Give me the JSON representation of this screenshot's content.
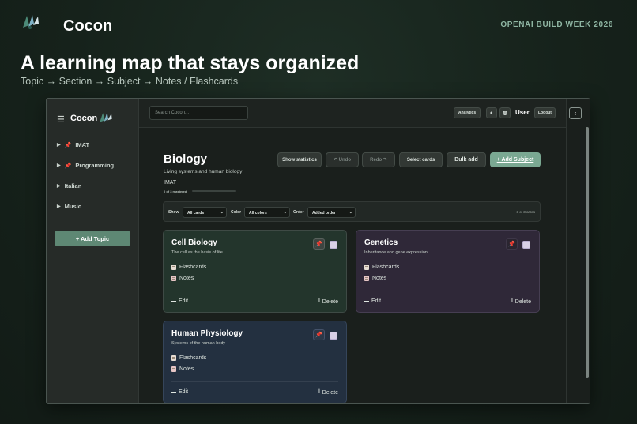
{
  "header": {
    "brand": "Cocon",
    "event": "OPENAI BUILD WEEK 2026",
    "headline": "A learning map that stays organized",
    "subline": "Topic → Section → Subject → Notes / Flashcards"
  },
  "sidebar": {
    "menu_icon": "☰",
    "brand": "Cocon",
    "topics": [
      {
        "label": "IMAT",
        "pinned": true
      },
      {
        "label": "Programming",
        "pinned": true
      },
      {
        "label": "Italian",
        "pinned": false
      },
      {
        "label": "Music",
        "pinned": false
      }
    ],
    "add_topic": "+ Add Topic"
  },
  "topbar": {
    "search_placeholder": "Search Cocon...",
    "analytics": "Analytics",
    "theme_icon": "◐",
    "lang_icon": "◍",
    "user": "User",
    "logout": "Logout",
    "collapse_icon": "‹"
  },
  "page": {
    "title": "Biology",
    "description": "Living systems and human biology",
    "tag": "IMAT",
    "progress_label": "0 of 3 mastered",
    "progress_fraction": 0,
    "actions": {
      "stats": "Show statistics",
      "undo": "↶ Undo",
      "redo": "Redo ↷",
      "select": "Select cards",
      "bulk": "Bulk add",
      "add_subject": "+ Add Subject"
    }
  },
  "filters": {
    "show_label": "Show",
    "show_value": "All cards",
    "color_label": "Color",
    "color_value": "All colors",
    "order_label": "Order",
    "order_value": "Added order",
    "count": "3 of 3 cards"
  },
  "cards": [
    {
      "title": "Cell Biology",
      "description": "The cell as the basis of life",
      "flashcards": "Flashcards",
      "notes": "Notes",
      "edit": "Edit",
      "delete": "Delete",
      "pin_icon": "📌",
      "color": "#23352c"
    },
    {
      "title": "Genetics",
      "description": "Inheritance and gene expression",
      "flashcards": "Flashcards",
      "notes": "Notes",
      "edit": "Edit",
      "delete": "Delete",
      "pin_icon": "📌",
      "color": "#2f2838"
    },
    {
      "title": "Human Physiology",
      "description": "Systems of the human body",
      "flashcards": "Flashcards",
      "notes": "Notes",
      "edit": "Edit",
      "delete": "Delete",
      "pin_icon": "📌",
      "color": "#233040"
    }
  ],
  "icons": {
    "pin": "📌",
    "arrow": "▶",
    "chevron": "⌄",
    "delete_glyph": "⫴"
  }
}
